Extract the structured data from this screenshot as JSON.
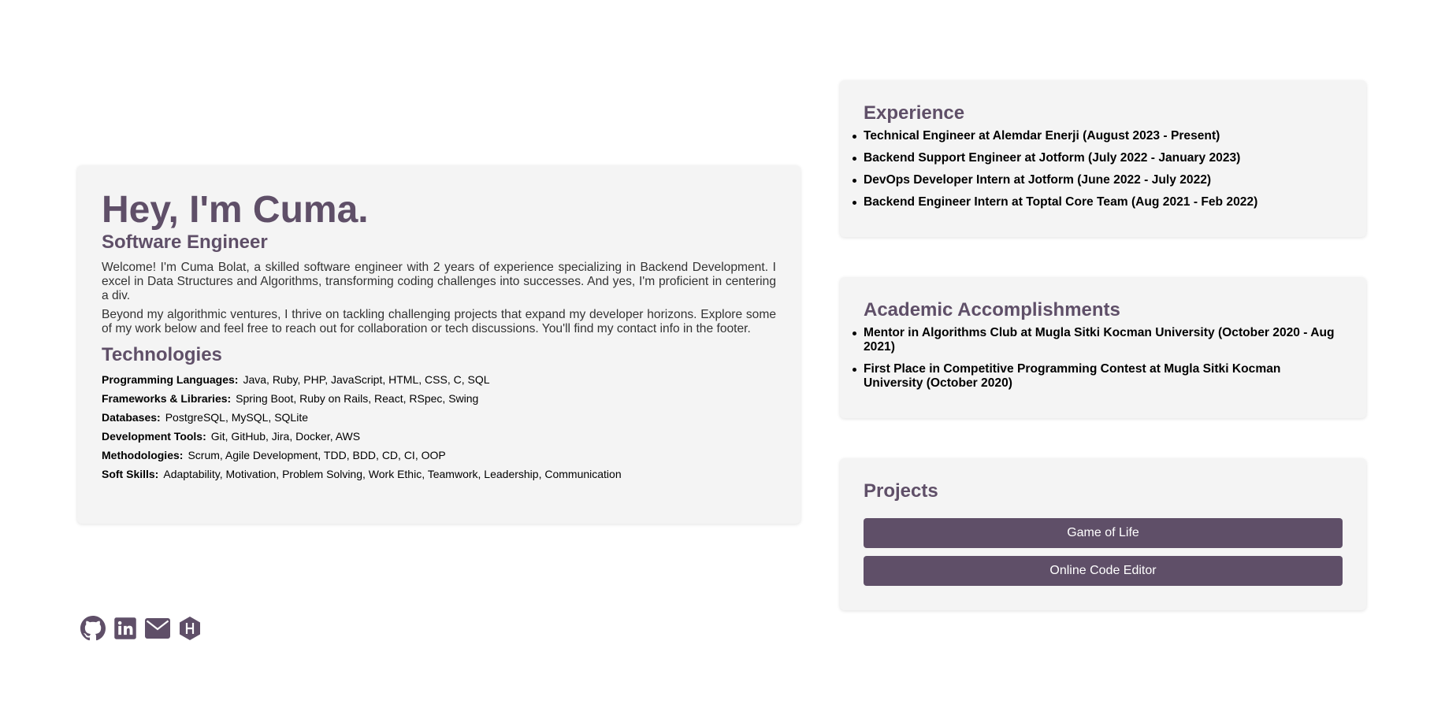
{
  "intro": {
    "heading": "Hey, I'm Cuma.",
    "subtitle": "Software Engineer",
    "paragraphs": [
      "Welcome! I'm Cuma Bolat, a skilled software engineer with 2 years of experience specializing in Backend Development. I excel in Data Structures and Algorithms, transforming coding challenges into successes. And yes, I'm proficient in centering a div.",
      "Beyond my algorithmic ventures, I thrive on tackling challenging projects that expand my developer horizons. Explore some of my work below and feel free to reach out for collaboration or tech discussions. You'll find my contact info in the footer."
    ],
    "tech_heading": "Technologies",
    "tech": [
      {
        "label": "Programming Languages:",
        "value": "Java, Ruby, PHP, JavaScript, HTML, CSS, C, SQL"
      },
      {
        "label": "Frameworks & Libraries:",
        "value": "Spring Boot, Ruby on Rails, React, RSpec, Swing"
      },
      {
        "label": "Databases:",
        "value": "PostgreSQL, MySQL, SQLite"
      },
      {
        "label": "Development Tools:",
        "value": "Git, GitHub, Jira, Docker, AWS"
      },
      {
        "label": "Methodologies:",
        "value": "Scrum, Agile Development, TDD, BDD, CD, CI, OOP"
      },
      {
        "label": "Soft Skills:",
        "value": "Adaptability, Motivation, Problem Solving, Work Ethic, Teamwork, Leadership, Communication"
      }
    ]
  },
  "experience": {
    "heading": "Experience",
    "items": [
      "Technical Engineer at Alemdar Enerji (August 2023 - Present)",
      "Backend Support Engineer at Jotform (July 2022 - January 2023)",
      "DevOps Developer Intern at Jotform (June 2022 - July 2022)",
      "Backend Engineer Intern at Toptal Core Team (Aug 2021 - Feb 2022)"
    ]
  },
  "academic": {
    "heading": "Academic Accomplishments",
    "items": [
      "Mentor in Algorithms Club at Mugla Sitki Kocman University (October 2020 - Aug 2021)",
      "First Place in Competitive Programming Contest at Mugla Sitki Kocman University (October 2020)"
    ]
  },
  "projects": {
    "heading": "Projects",
    "buttons": [
      "Game of Life",
      "Online Code Editor"
    ]
  },
  "socials": {
    "icons": [
      "github-icon",
      "linkedin-icon",
      "email-icon",
      "hackerrank-icon"
    ],
    "icon_color": "#5f4f68"
  },
  "theme": {
    "accent": "#5f4f68",
    "card_bg": "#f4f4f4"
  }
}
